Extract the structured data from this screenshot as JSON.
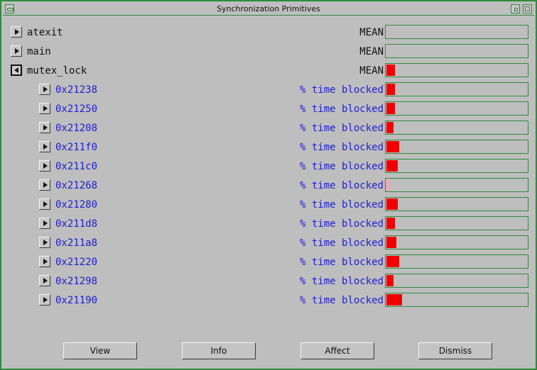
{
  "window": {
    "title": "Synchronization Primitives"
  },
  "rows": [
    {
      "label": "atexit",
      "metric": "MEAN",
      "level": 0,
      "expanded": false,
      "value": 0
    },
    {
      "label": "main",
      "metric": "MEAN",
      "level": 0,
      "expanded": false,
      "value": 0
    },
    {
      "label": "mutex_lock",
      "metric": "MEAN",
      "level": 0,
      "expanded": true,
      "value": 0.06
    },
    {
      "label": "0x21238",
      "metric": "% time blocked",
      "level": 1,
      "expanded": false,
      "value": 0.06
    },
    {
      "label": "0x21250",
      "metric": "% time blocked",
      "level": 1,
      "expanded": false,
      "value": 0.06
    },
    {
      "label": "0x21208",
      "metric": "% time blocked",
      "level": 1,
      "expanded": false,
      "value": 0.05
    },
    {
      "label": "0x211f0",
      "metric": "% time blocked",
      "level": 1,
      "expanded": false,
      "value": 0.09
    },
    {
      "label": "0x211c0",
      "metric": "% time blocked",
      "level": 1,
      "expanded": false,
      "value": 0.08
    },
    {
      "label": "0x21268",
      "metric": "% time blocked",
      "level": 1,
      "expanded": false,
      "value": 0.02,
      "low": true
    },
    {
      "label": "0x21280",
      "metric": "% time blocked",
      "level": 1,
      "expanded": false,
      "value": 0.08
    },
    {
      "label": "0x211d8",
      "metric": "% time blocked",
      "level": 1,
      "expanded": false,
      "value": 0.06
    },
    {
      "label": "0x211a8",
      "metric": "% time blocked",
      "level": 1,
      "expanded": false,
      "value": 0.07
    },
    {
      "label": "0x21220",
      "metric": "% time blocked",
      "level": 1,
      "expanded": false,
      "value": 0.09
    },
    {
      "label": "0x21298",
      "metric": "% time blocked",
      "level": 1,
      "expanded": false,
      "value": 0.05
    },
    {
      "label": "0x21190",
      "metric": "% time blocked",
      "level": 1,
      "expanded": false,
      "value": 0.11
    }
  ],
  "buttons": {
    "view": "View",
    "info": "Info",
    "affect": "Affect",
    "dismiss": "Dismiss"
  },
  "colors": {
    "frame": "#2e8b3a",
    "bar_fill": "#f00000",
    "bar_fill_low": "#f3a6b0",
    "sub_text": "#2020d0"
  }
}
